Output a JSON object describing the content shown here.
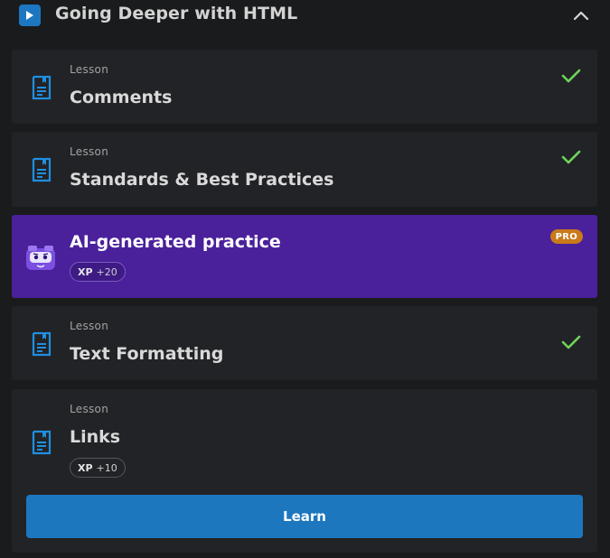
{
  "section": {
    "title": "Going Deeper with HTML",
    "icon": "play-icon",
    "toggle_icon": "chevron-up-icon"
  },
  "items": [
    {
      "type": "lesson",
      "overline": "Lesson",
      "title": "Comments",
      "completed": true,
      "icon": "lesson-document-icon"
    },
    {
      "type": "lesson",
      "overline": "Lesson",
      "title": "Standards & Best Practices",
      "completed": true,
      "icon": "lesson-document-icon"
    },
    {
      "type": "practice",
      "title": "AI-generated practice",
      "badge": "PRO",
      "xp_label": "XP",
      "xp_value": "+20",
      "icon": "ai-bot-avatar-icon"
    },
    {
      "type": "lesson",
      "overline": "Lesson",
      "title": "Text Formatting",
      "completed": true,
      "icon": "lesson-document-icon"
    },
    {
      "type": "lesson",
      "overline": "Lesson",
      "title": "Links",
      "completed": false,
      "xp_label": "XP",
      "xp_value": "+10",
      "button_label": "Learn",
      "icon": "lesson-document-icon"
    }
  ],
  "colors": {
    "background": "#1a1b1d",
    "card": "#222326",
    "accent_blue": "#1d77bf",
    "practice_purple": "#4a209b",
    "check_green": "#6fd35a",
    "pro_orange": "#c97a1a"
  }
}
